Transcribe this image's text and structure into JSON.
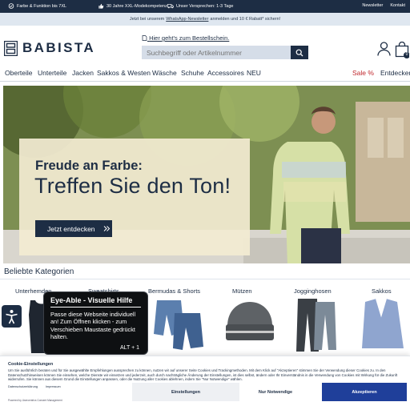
{
  "topbar": {
    "usp": [
      {
        "icon": "check-badge-icon",
        "text": "Farbe & Funktion bis 7XL"
      },
      {
        "icon": "thumbs-up-icon",
        "text": "30 Jahre XXL-Modekompetenz"
      },
      {
        "icon": "truck-icon",
        "text": "Unser Versprechen: 1-3 Tage"
      }
    ],
    "links": [
      "Newsletter",
      "Kontakt"
    ]
  },
  "promo": {
    "before": "Jetzt bei unserem",
    "link": "WhatsApp-Newsletter",
    "after": "anmelden und 10 € Rabatt* sichern!"
  },
  "header": {
    "logo_text": "BABISTA",
    "order_link": "Hier geht's zum Bestellschein.",
    "search_placeholder": "Suchbegriff oder Artikelnummer",
    "cart_count": "0"
  },
  "nav": {
    "items": [
      "Oberteile",
      "Unterteile",
      "Jacken",
      "Sakkos & Westen",
      "Wäsche",
      "Schuhe",
      "Accessoires",
      "NEU"
    ],
    "sale": "Sale %",
    "discover": "Entdecken"
  },
  "hero": {
    "title_line1": "Freude an Farbe:",
    "title_line2": "Treffen Sie den Ton!",
    "cta": "Jetzt entdecken"
  },
  "categories": {
    "title": "Beliebte Kategorien",
    "items": [
      "Unterhemden",
      "Sweatshirts",
      "Bermudas & Shorts",
      "Mützen",
      "Jogginghosen",
      "Sakkos"
    ]
  },
  "accessibility": {
    "title": "Eye-Able - Visuelle Hilfe",
    "body": "Passe diese Webseite individuell an! Zum Öffnen klicken - zum Verschieben Maustaste gedrückt halten.",
    "shortcut": "ALT + 1"
  },
  "cookie": {
    "title": "Cookie-Einstellungen",
    "text": "Um Sie ausführlich beraten und für Sie ausgewählte Empfehlungen aussprechen zu können, nutzen wir auf unserer Seite Cookies und Trackingmethoden. Mit dem Klick auf \"Akzeptieren\" stimmen Sie der Verwendung dieser Cookies zu. In den Datenschutzhinweisen können Sie einsehen, welche Dienste wir einsetzen und jederzeit, auch durch nachträgliche Änderung der Einstellungen, ist dies selbst, ändern oder Ihr Einverständnis in die Verwendung von Cookies mit Wirkung für die Zukunft widerrufen. Sie können aus diesem Grund die Einstellungen anpassen, oder die Nutzung aller Cookies ablehnen, indem Sie \"Nur Notwendige\" wählen.",
    "links": [
      "Datenschutzerklärung",
      "Impressum"
    ],
    "btn_settings": "Einstellungen",
    "btn_necessary": "Nur Notwendige",
    "btn_accept": "Akzeptieren",
    "footer": "Powered by Usercentrics Consent Management"
  },
  "colors": {
    "navy": "#1d2d44",
    "promo_bg": "#dfe7f0",
    "sale_red": "#c0282d",
    "accept_blue": "#1f3f9a"
  }
}
